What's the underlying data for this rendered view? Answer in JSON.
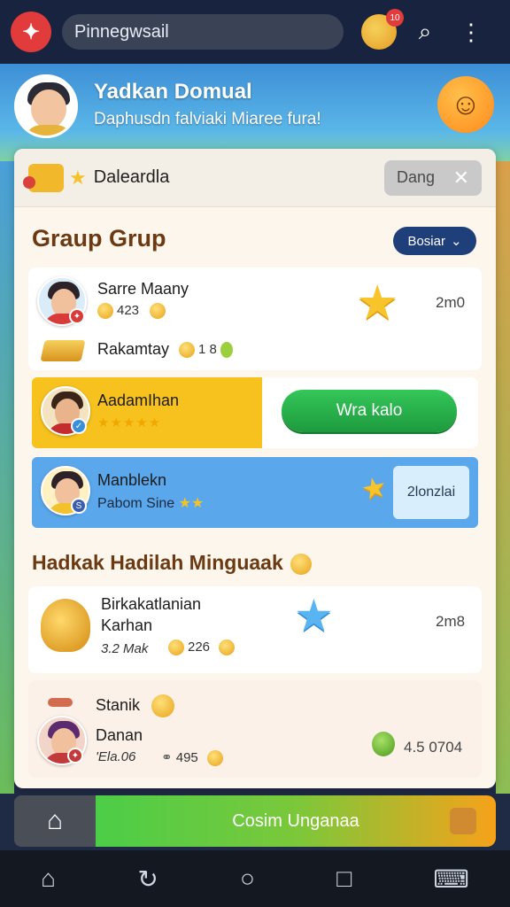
{
  "topbar": {
    "app_title": "Pinnegwsail",
    "notification_count": "10"
  },
  "banner": {
    "title": "Yadkan Domual",
    "subtitle": "Daphusdn falviaki Miaree fura!"
  },
  "panel": {
    "header_title": "Daleardla",
    "header_button": "Dang"
  },
  "group_section": {
    "title": "Graup Grup",
    "select_label": "Bosiar",
    "members": [
      {
        "name": "Sarre Maany",
        "points": "423",
        "rank": "2m0"
      },
      {
        "name": "Rakamtay",
        "points": "1 8"
      },
      {
        "name": "AadamIhan",
        "stars": "★★★★★",
        "button": "Wra kalo"
      },
      {
        "name": "Manblekn",
        "sub": "Pabom Sine",
        "button": "2lonzlai"
      }
    ]
  },
  "rewards_section": {
    "title": "Hadkak Hadilah Minguaak",
    "items": [
      {
        "name": "Birkakatlanian",
        "sub": "Karhan",
        "meta": "3.2 Mak",
        "points": "226",
        "rank": "2m8"
      },
      {
        "label": "Stanik",
        "name": "Danan",
        "meta": "'Ela.06",
        "points": "495",
        "value": "4.5 0704"
      }
    ]
  },
  "bottom": {
    "cta_label": "Cosim Unganaa"
  },
  "colors": {
    "accent_green": "#34c759",
    "select_blue": "#1f3f7a",
    "highlight_yellow": "#f7c21e"
  }
}
